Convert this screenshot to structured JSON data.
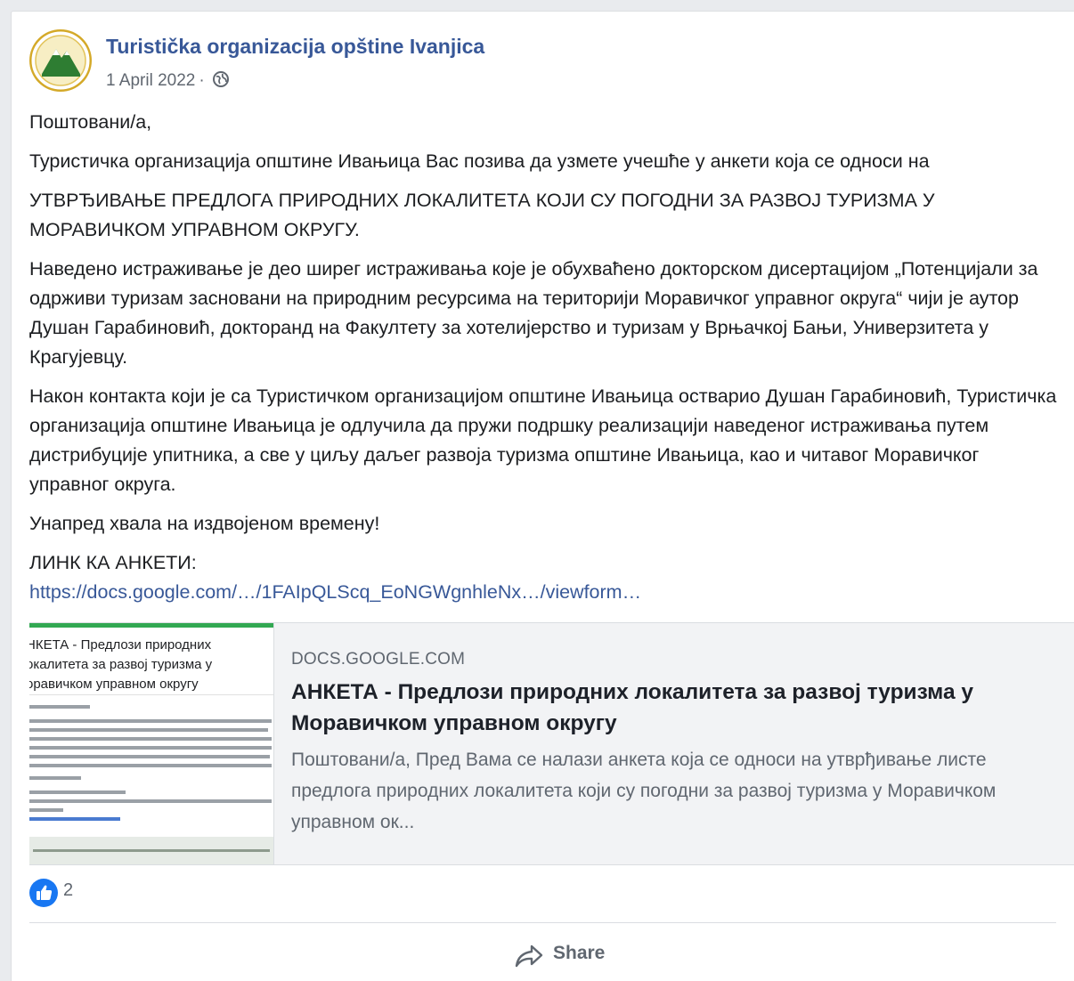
{
  "post": {
    "page_name": "Turistička organizacija opštine Ivanjica",
    "date": "1 April 2022",
    "separator": "·",
    "audience_icon": "globe-icon",
    "paragraphs": [
      "Поштовани/а,",
      "Туристичка организација општине Ивањица Вас позива да узмете учешће у анкети која се односи на",
      "УТВРЂИВАЊЕ ПРЕДЛОГА ПРИРОДНИХ ЛОКАЛИТЕТА КОЈИ СУ ПОГОДНИ ЗА РАЗВОЈ ТУРИЗМА У МОРАВИЧКОМ УПРАВНОМ ОКРУГУ.",
      "Наведено истраживање је део ширег истраживања које је обухваћено докторском дисертацијом „Потенцијали за одрживи туризам засновани на природним ресурсима на територији Моравичког управног округа“ чији је аутор Душан Гарабиновић, докторанд на Факултету за хотелијерство и туризам у Врњачкој Бањи, Универзитета у Крагујевцу.",
      "Након контакта који је са Туристичком организацијом општине Ивањица остварио Душан Гарабиновић, Туристичка организација општине Ивањица је одлучила да пружи подршку реализацији наведеног истраживања путем дистрибуције упитника, а све у циљу даљег развоја туризма општине Ивањица, као и читавог Моравичког управног округа.",
      "Унапред хвала на издвојеном времену!"
    ],
    "link_label": "ЛИНК КА АНКЕТИ:",
    "link_text": "https://docs.google.com/…/1FAIpQLScq_EoNGWgnhleNx…/viewform…"
  },
  "preview": {
    "thumb_title": "НКЕТА - Предлози природних\nокалитета за развој туризма у\nоравичком управном округу",
    "domain": "DOCS.GOOGLE.COM",
    "title": "АНКЕТА - Предлози природних локалитета за развој туризма у Моравичком управном округу",
    "description": "Поштовани/а, Пред Вама се налази анкета која се односи на утврђивање листе предлога природних локалитета који су погодни за развој туризма у Моравичком управном ок..."
  },
  "reactions": {
    "icon": "like-icon",
    "count": "2"
  },
  "actions": {
    "share_icon": "share-arrow-icon",
    "share_label": "Share"
  },
  "colors": {
    "link": "#385898",
    "muted": "#606770",
    "like": "#1877f2",
    "logo_green": "#2e7d32",
    "logo_gold": "#d4a928"
  }
}
